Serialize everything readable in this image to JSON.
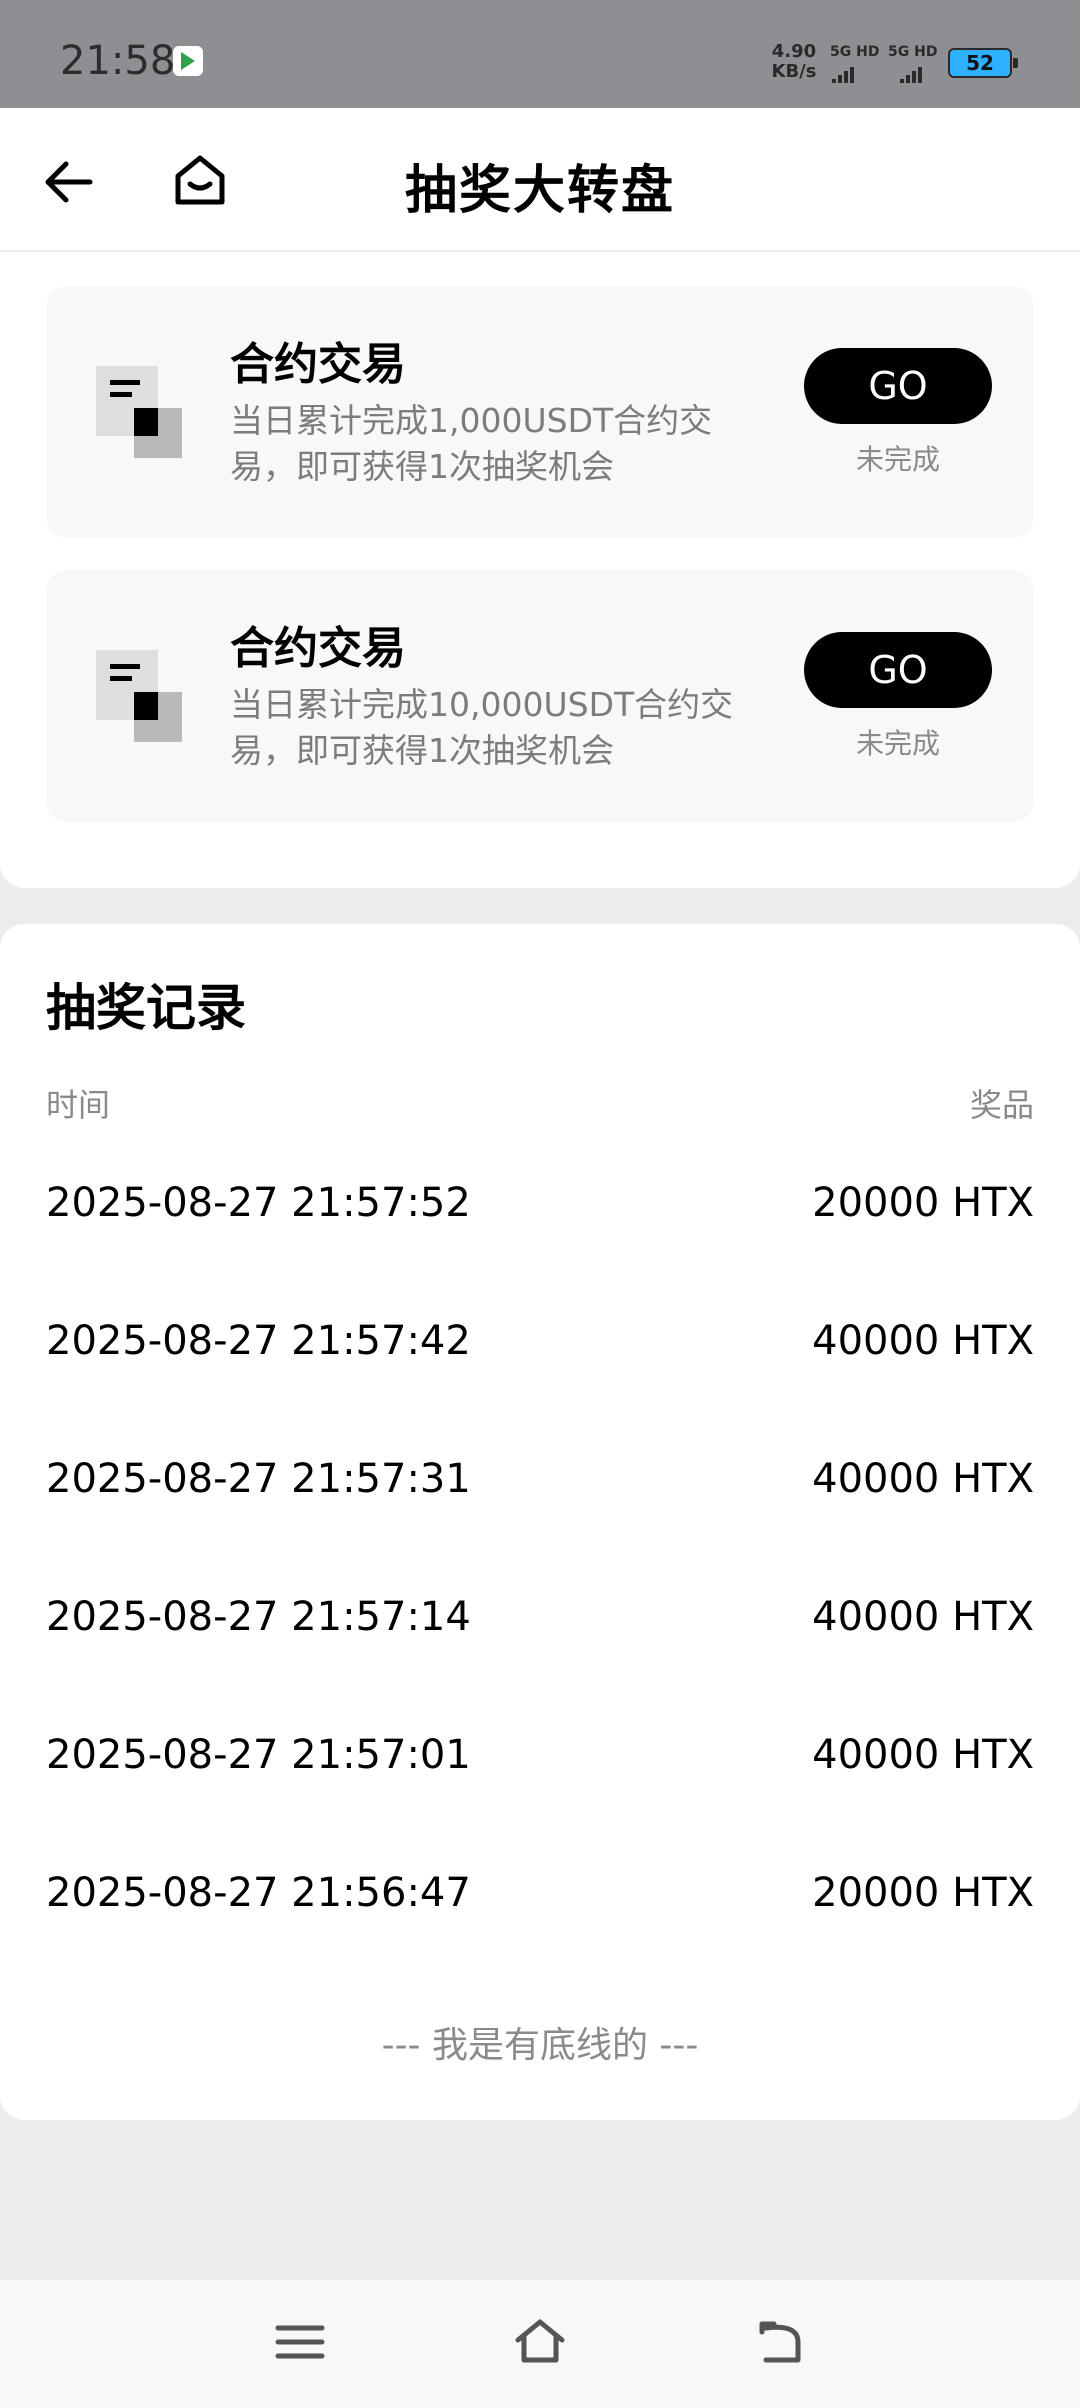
{
  "status_bar": {
    "time": "21:58",
    "speed_value": "4.90",
    "speed_unit": "KB/s",
    "net1": "5G HD",
    "net2": "5G HD",
    "battery": "52",
    "battery_color": "#2cb0ff"
  },
  "header": {
    "title": "抽奖大转盘",
    "back_icon": "arrow-left-icon",
    "home_icon": "home-icon"
  },
  "tasks": [
    {
      "title": "合约交易",
      "desc": "当日累计完成1,000USDT合约交易，即可获得1次抽奖机会",
      "button": "GO",
      "status": "未完成"
    },
    {
      "title": "合约交易",
      "desc": "当日累计完成10,000USDT合约交易，即可获得1次抽奖机会",
      "button": "GO",
      "status": "未完成"
    }
  ],
  "records": {
    "title": "抽奖记录",
    "col_time": "时间",
    "col_prize": "奖品",
    "rows": [
      {
        "time": "2025-08-27 21:57:52",
        "prize": "20000 HTX"
      },
      {
        "time": "2025-08-27 21:57:42",
        "prize": "40000 HTX"
      },
      {
        "time": "2025-08-27 21:57:31",
        "prize": "40000 HTX"
      },
      {
        "time": "2025-08-27 21:57:14",
        "prize": "40000 HTX"
      },
      {
        "time": "2025-08-27 21:57:01",
        "prize": "40000 HTX"
      },
      {
        "time": "2025-08-27 21:56:47",
        "prize": "20000 HTX"
      }
    ],
    "bottom_text": "--- 我是有底线的 ---"
  },
  "nav": {
    "menu_icon": "menu-icon",
    "home_icon": "home-outline-icon",
    "back_icon": "return-icon"
  }
}
